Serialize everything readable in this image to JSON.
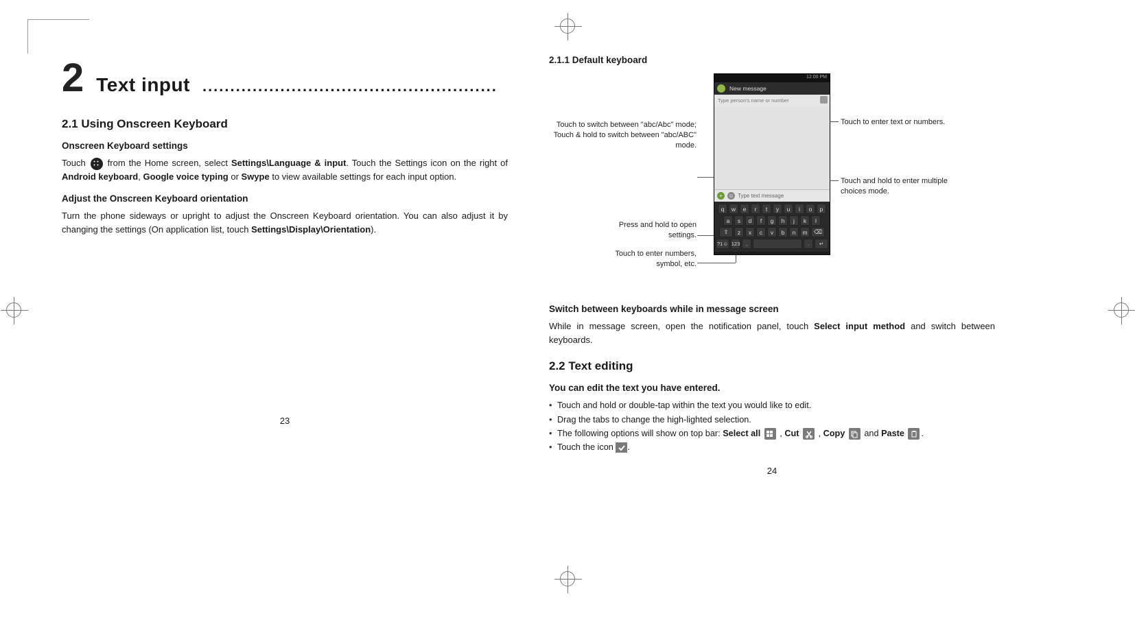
{
  "chapter": {
    "number": "2",
    "title": "Text input",
    "dots": "....................................................."
  },
  "left": {
    "s21": "2.1    Using Onscreen Keyboard",
    "sub1": "Onscreen Keyboard settings",
    "p1a": "Touch ",
    "p1b": " from the Home screen, select ",
    "p1c": "Settings\\Language & input",
    "p1d": ". Touch the Settings icon on the right of ",
    "p1e": "Android keyboard",
    "p1f": ", ",
    "p1g": "Google voice typing",
    "p1h": " or ",
    "p1i": "Swype",
    "p1j": " to view available settings for each input option.",
    "sub2": "Adjust the Onscreen Keyboard orientation",
    "p2a": "Turn the phone sideways or upright to adjust the Onscreen Keyboard orientation. You can also adjust it by changing the settings (On application list, touch ",
    "p2b": "Settings\\Display\\Orientation",
    "p2c": ").",
    "page_num": "23"
  },
  "right": {
    "s211": "2.1.1   Default keyboard",
    "phone": {
      "time": "12:00 PM",
      "title": "New message",
      "recipient_placeholder": "Type person's name or number",
      "compose_placeholder": "Type text message",
      "rows": {
        "r1": [
          "q",
          "w",
          "e",
          "r",
          "t",
          "y",
          "u",
          "i",
          "o",
          "p"
        ],
        "r2": [
          "a",
          "s",
          "d",
          "f",
          "g",
          "h",
          "j",
          "k",
          "l"
        ],
        "r3": [
          "⇧",
          "z",
          "x",
          "c",
          "v",
          "b",
          "n",
          "m",
          "⌫"
        ],
        "r4": [
          "?1☺",
          "123",
          ",",
          ".",
          " ",
          "↵"
        ]
      }
    },
    "callouts": {
      "c1": "Touch to switch between \"abc/Abc\" mode; Touch & hold to switch between \"abc/ABC\" mode.",
      "c2": "Press and hold to open settings.",
      "c3": "Touch to enter numbers, symbol, etc.",
      "c4": "Touch to enter text or numbers.",
      "c5": "Touch and hold to enter multiple choices mode."
    },
    "sub3": "Switch between keyboards while in message screen",
    "p3a": "While in message screen, open the notification panel, touch ",
    "p3b": "Select input method",
    "p3c": " and switch between keyboards.",
    "s22": "2.2    Text editing",
    "sub4": "You can edit the text you have entered.",
    "b1": "Touch and hold or double-tap within the text you would like to edit.",
    "b2": "Drag the tabs to change the high-lighted selection.",
    "b3a": "The following options will show on top bar: ",
    "b3_selectall": "Select all",
    "b3_cut": "Cut",
    "b3_copy": "Copy",
    "b3_paste": "Paste",
    "b3_and": " and ",
    "b4": "Touch the icon ",
    "page_num": "24"
  }
}
